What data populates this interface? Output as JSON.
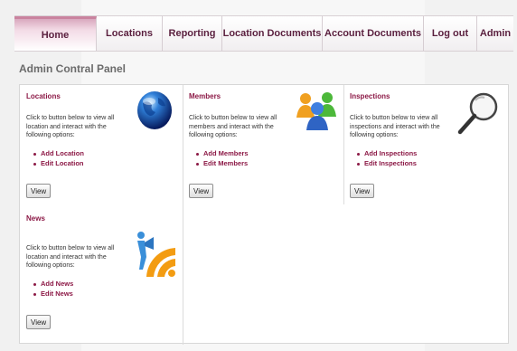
{
  "nav": {
    "items": [
      {
        "label": "Home",
        "active": true
      },
      {
        "label": "Locations"
      },
      {
        "label": "Reporting"
      },
      {
        "label": "Location Documents"
      },
      {
        "label": "Account Documents"
      },
      {
        "label": "Log out"
      },
      {
        "label": "Admin"
      }
    ]
  },
  "page": {
    "title": "Admin Contral Panel"
  },
  "sections": {
    "locations": {
      "title": "Locations",
      "description": "Click to button below to view all location and interact with the following options:",
      "links": [
        "Add Location",
        "Edit Location"
      ],
      "button": "View",
      "icon": "globe-icon"
    },
    "members": {
      "title": "Members",
      "description": "Click to button below to view all members and interact with the following options:",
      "links": [
        "Add Members",
        "Edit Members"
      ],
      "button": "View",
      "icon": "people-icon"
    },
    "inspections": {
      "title": "Inspections",
      "description": "Click to button below to view all inspections and interact with the following options:",
      "links": [
        "Add Inspections",
        "Edit Inspections"
      ],
      "button": "View",
      "icon": "magnifier-icon"
    },
    "news": {
      "title": "News",
      "description": "Click to button below to view all location and interact with the following options:",
      "links": [
        "Add News",
        "Edit News"
      ],
      "button": "View",
      "icon": "news-feed-icon"
    }
  },
  "colors": {
    "accent": "#8c1946",
    "nav_text": "#5a1f3e",
    "active_tab": "#d9a8be"
  }
}
